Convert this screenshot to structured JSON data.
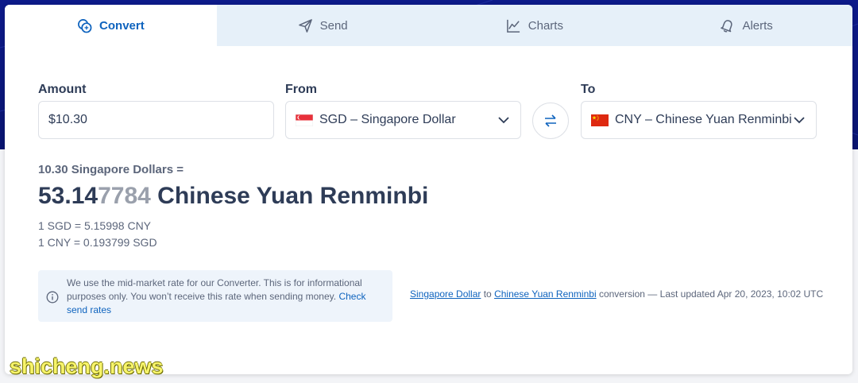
{
  "tabs": [
    {
      "label": "Convert",
      "icon": "convert-coins-icon",
      "active": true
    },
    {
      "label": "Send",
      "icon": "send-plane-icon",
      "active": false
    },
    {
      "label": "Charts",
      "icon": "line-chart-icon",
      "active": false
    },
    {
      "label": "Alerts",
      "icon": "bell-icon",
      "active": false
    }
  ],
  "amount": {
    "label": "Amount",
    "value": "$10.30"
  },
  "from": {
    "label": "From",
    "code": "SGD",
    "name": " – Singapore Dollar",
    "flag": "singapore-flag-icon"
  },
  "to": {
    "label": "To",
    "code": "CNY",
    "name": " – Chinese Yuan Renminbi",
    "flag": "china-flag-icon"
  },
  "swap": {
    "icon": "swap-arrows-icon"
  },
  "result": {
    "sub": "10.30 Singapore Dollars =",
    "main_strong": "53.14",
    "main_faded": "7784",
    "main_unit": " Chinese Yuan Renminbi",
    "rate1": "1 SGD = 5.15998 CNY",
    "rate2": "1 CNY = 0.193799 SGD"
  },
  "info": {
    "text": "We use the mid-market rate for our Converter. This is for informational purposes only. You won’t receive this rate when sending money. ",
    "link": "Check send rates"
  },
  "conversion": {
    "from_link": "Singapore Dollar",
    "to_word": " to ",
    "to_link": "Chinese Yuan Renminbi",
    "rest": " conversion — Last updated Apr 20, 2023, 10:02 UTC"
  },
  "watermark": "shicheng.news",
  "colors": {
    "accent": "#0e63be",
    "header_bg": "#0d1a8a",
    "tab_bg": "#e6f0f9",
    "text": "#2e3c57"
  }
}
